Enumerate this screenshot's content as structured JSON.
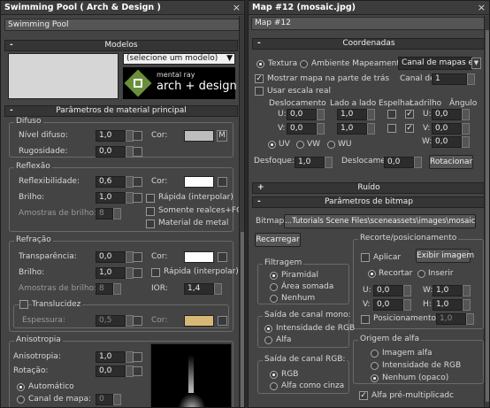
{
  "left_window": {
    "title": "Swimming Pool  ( Arch & Design )",
    "close": "×",
    "material_name": "Swimming Pool",
    "templates_header": "Modelos",
    "templates_select": "(selecione um modelo)",
    "brand_top": "mental ray",
    "brand_main": "arch + design",
    "main_params_header": "Parâmetros de material principal",
    "diffuse": {
      "title": "Difuso",
      "level_label": "Nível difuso:",
      "level": "1,0",
      "roughness_label": "Rugosidade:",
      "roughness": "0,0",
      "color_label": "Cor:",
      "color": "#bdbdbd",
      "map_btn": "M"
    },
    "reflection": {
      "title": "Reflexão",
      "refl_label": "Reflexibilidade:",
      "refl": "0,6",
      "gloss_label": "Brilho:",
      "gloss": "1,0",
      "samples_label": "Amostras de brilho:",
      "samples": "8",
      "color_label": "Cor:",
      "color": "#ffffff",
      "fast_label": "Rápida (interpolar)",
      "highlights_label": "Somente realces+FG",
      "metal_label": "Material de metal"
    },
    "refraction": {
      "title": "Refração",
      "transp_label": "Transparência:",
      "transp": "0,0",
      "gloss_label": "Brilho:",
      "gloss": "1,0",
      "samples_label": "Amostras de brilho:",
      "samples": "8",
      "color_label": "Cor:",
      "color": "#ffffff",
      "fast_label": "Rápida (interpolar)",
      "ior_label": "IOR:",
      "ior": "1,4",
      "translucency_label": "Translucidez",
      "thickness_label": "Espessura:",
      "thickness": "0,5",
      "tcolor_label": "Cor:",
      "tcolor": "#d8b877"
    },
    "anisotropy": {
      "title": "Anisotropia",
      "aniso_label": "Anisotropia:",
      "aniso": "1,0",
      "rotation_label": "Rotação:",
      "rotation": "0,0",
      "auto_label": "Automático",
      "mapchan_label": "Canal de mapa:",
      "mapchan": "0"
    }
  },
  "right_window": {
    "title": "Map #12 (mosaic.jpg)",
    "close": "×",
    "map_name": "Map #12",
    "coords_header": "Coordenadas",
    "texture_label": "Textura",
    "env_label": "Ambiente Mapeamento:",
    "env_select": "Canal de mapas e",
    "show_back_label": "Mostrar mapa na parte de trás",
    "map_channel_label": "Canal de",
    "map_channel": "1",
    "real_scale_label": "Usar escala real",
    "offset_label": "Deslocamento",
    "tiling_label": "Lado a lado",
    "mirror_label": "Espelhar",
    "tile_label": "Ladrilho",
    "angle_label": "Ângulo",
    "u_label": "U:",
    "v_label": "V:",
    "w_label": "W:",
    "u_offset": "0,0",
    "v_offset": "0,0",
    "u_tiling": "1,0",
    "v_tiling": "1,0",
    "u_angle": "0,0",
    "v_angle": "0,0",
    "w_angle": "0,0",
    "uv_label": "UV",
    "vw_label": "VW",
    "wu_label": "WU",
    "blur_label": "Desfoque:",
    "blur": "1,0",
    "blur_offset_label": "Deslocamer",
    "blur_offset": "0,0",
    "rotate_btn": "Rotacionar",
    "noise_header": "Ruído",
    "bitmap_header": "Parâmetros de bitmap",
    "bitmap_label": "Bitmap:",
    "bitmap_path": "...Tutorials Scene Files\\sceneassets\\images\\mosaic.jpg",
    "reload_btn": "Recarregar",
    "crop_title": "Recorte/posicionamento",
    "apply_label": "Aplicar",
    "view_image_btn": "Exibir imagem",
    "crop_label": "Recortar",
    "place_label": "Inserir",
    "cu_label": "U:",
    "cu": "0,0",
    "cw_label": "W:",
    "cw": "1,0",
    "cv_label": "V:",
    "cv": "0,0",
    "ch_label": "H:",
    "ch": "1,0",
    "jitter_label": "Posicionamento",
    "jitter": "1,0",
    "filter_title": "Filtragem",
    "pyramidal_label": "Piramidal",
    "summed_label": "Área somada",
    "none_label": "Nenhum",
    "mono_title": "Saída de canal mono:",
    "rgb_int_label": "Intensidade de RGB",
    "alpha_label": "Alfa",
    "rgb_title": "Saída de canal RGB:",
    "rgb_label": "RGB",
    "alpha_gray_label": "Alfa como cinza",
    "alpha_src_title": "Origem de alfa",
    "alpha_img_label": "Imagem alfa",
    "alpha_int_label": "Intensidade de RGB",
    "alpha_none_label": "Nenhum (opaco)",
    "premult_label": "Alfa pré-multiplicadc"
  }
}
